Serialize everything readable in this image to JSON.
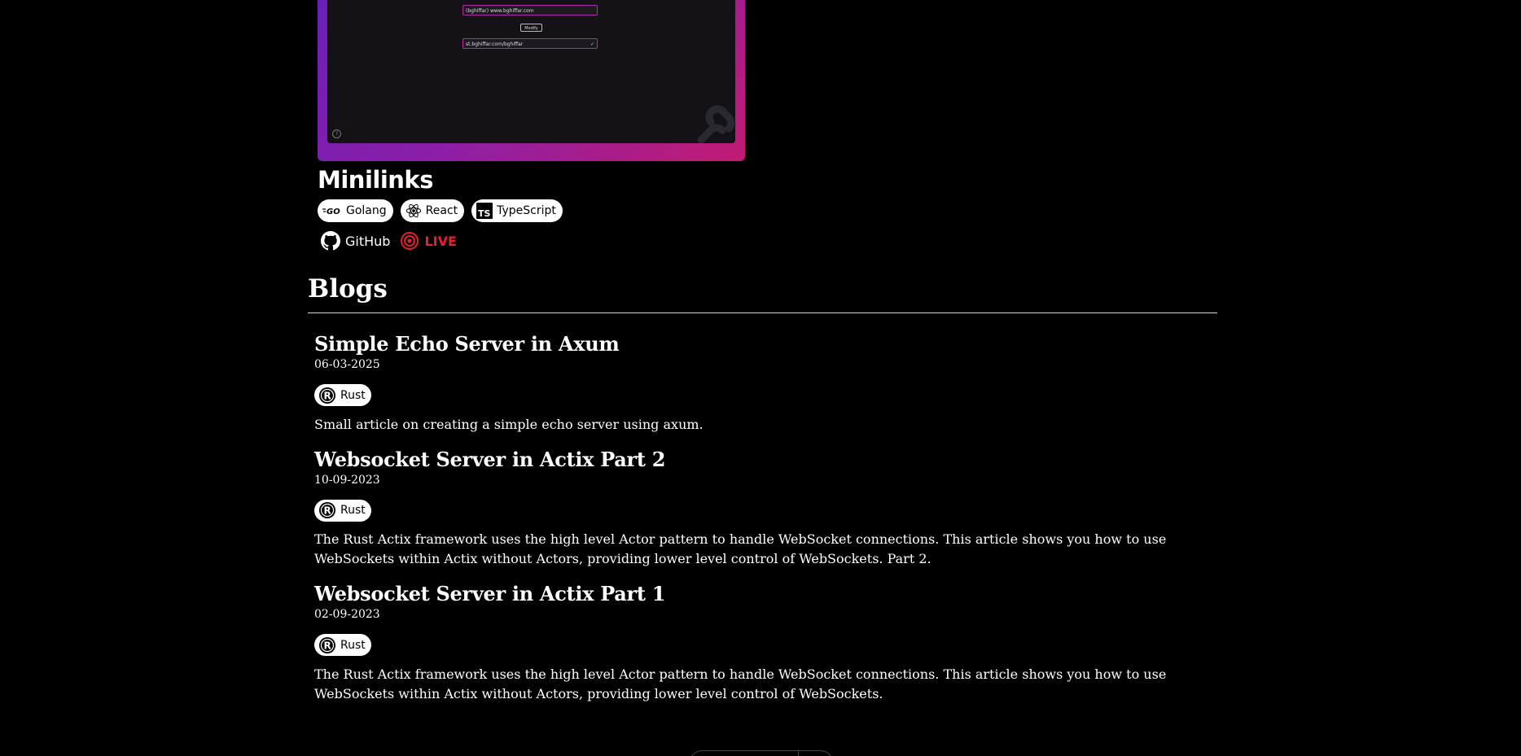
{
  "project": {
    "preview": {
      "input_text": "(bghiffar) www.bghiffar.com",
      "button_label": "Modify",
      "result_text": "st.bghiffar.com/bghiffar",
      "check_icon": "check-icon",
      "help_icon": "help-icon"
    },
    "title": "Minilinks",
    "tech": [
      {
        "label": "Golang",
        "icon": "golang-icon"
      },
      {
        "label": "React",
        "icon": "react-icon"
      },
      {
        "label": "TypeScript",
        "icon": "typescript-icon"
      }
    ],
    "links": {
      "github_label": "GitHub",
      "live_label": "LIVE"
    },
    "colors": {
      "live": "#e5202f",
      "frame_start": "#6b1fb8",
      "frame_end": "#c21b72"
    }
  },
  "blogs": {
    "heading": "Blogs",
    "posts": [
      {
        "title": "Simple Echo Server in Axum",
        "date": "06-03-2025",
        "tag": "Rust",
        "description": "Small article on creating a simple echo server using axum."
      },
      {
        "title": "Websocket Server in Actix Part 2",
        "date": "10-09-2023",
        "tag": "Rust",
        "description": "The Rust Actix framework uses the high level Actor pattern to handle WebSocket connections. This article shows you how to use WebSockets within Actix without Actors, providing lower level control of WebSockets. Part 2."
      },
      {
        "title": "Websocket Server in Actix Part 1",
        "date": "02-09-2023",
        "tag": "Rust",
        "description": "The Rust Actix framework uses the high level Actor pattern to handle WebSocket connections. This article shows you how to use WebSockets within Actix without Actors, providing lower level control of WebSockets."
      }
    ]
  }
}
